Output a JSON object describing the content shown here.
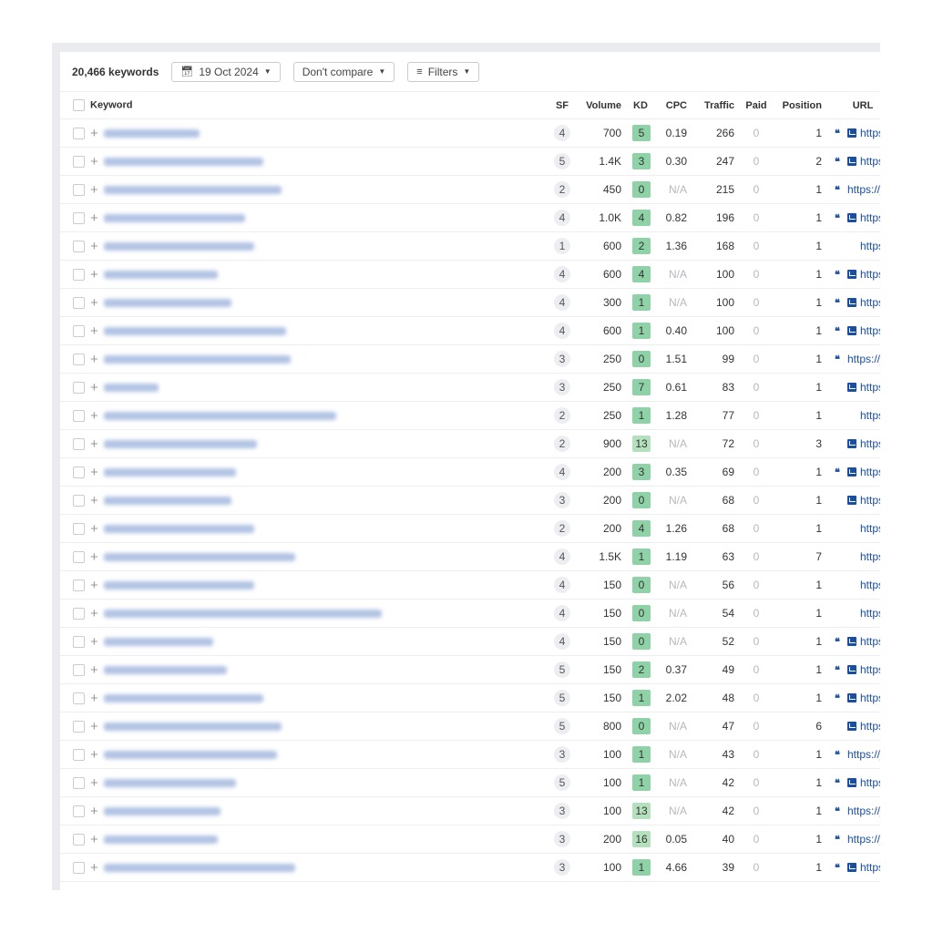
{
  "toolbar": {
    "keyword_count": "20,466 keywords",
    "date_label": "19 Oct 2024",
    "compare_label": "Don't compare",
    "filters_label": "Filters",
    "calendar_icon": "calendar-icon",
    "filter_icon": "filter-icon"
  },
  "columns": {
    "keyword": "Keyword",
    "sf": "SF",
    "volume": "Volume",
    "kd": "KD",
    "cpc": "CPC",
    "traffic": "Traffic",
    "paid": "Paid",
    "position": "Position",
    "url": "URL"
  },
  "colors": {
    "kd_easy": "#8fd2a7",
    "kd_light": "#b5e0bd",
    "link": "#1a4fa0"
  },
  "rows": [
    {
      "sf": "4",
      "volume": "700",
      "kd": "5",
      "cpc": "0.19",
      "traffic": "266",
      "paid": "0",
      "position": "1",
      "quote": true,
      "image": true,
      "url": "https"
    },
    {
      "sf": "5",
      "volume": "1.4K",
      "kd": "3",
      "cpc": "0.30",
      "traffic": "247",
      "paid": "0",
      "position": "2",
      "quote": true,
      "image": true,
      "url": "https"
    },
    {
      "sf": "2",
      "volume": "450",
      "kd": "0",
      "cpc": "N/A",
      "traffic": "215",
      "paid": "0",
      "position": "1",
      "quote": true,
      "image": false,
      "url": "https://j"
    },
    {
      "sf": "4",
      "volume": "1.0K",
      "kd": "4",
      "cpc": "0.82",
      "traffic": "196",
      "paid": "0",
      "position": "1",
      "quote": true,
      "image": true,
      "url": "https"
    },
    {
      "sf": "1",
      "volume": "600",
      "kd": "2",
      "cpc": "1.36",
      "traffic": "168",
      "paid": "0",
      "position": "1",
      "quote": false,
      "image": false,
      "url": "https://j"
    },
    {
      "sf": "4",
      "volume": "600",
      "kd": "4",
      "cpc": "N/A",
      "traffic": "100",
      "paid": "0",
      "position": "1",
      "quote": true,
      "image": true,
      "url": "https"
    },
    {
      "sf": "4",
      "volume": "300",
      "kd": "1",
      "cpc": "N/A",
      "traffic": "100",
      "paid": "0",
      "position": "1",
      "quote": true,
      "image": true,
      "url": "https"
    },
    {
      "sf": "4",
      "volume": "600",
      "kd": "1",
      "cpc": "0.40",
      "traffic": "100",
      "paid": "0",
      "position": "1",
      "quote": true,
      "image": true,
      "url": "https"
    },
    {
      "sf": "3",
      "volume": "250",
      "kd": "0",
      "cpc": "1.51",
      "traffic": "99",
      "paid": "0",
      "position": "1",
      "quote": true,
      "image": false,
      "url": "https://j"
    },
    {
      "sf": "3",
      "volume": "250",
      "kd": "7",
      "cpc": "0.61",
      "traffic": "83",
      "paid": "0",
      "position": "1",
      "quote": false,
      "image": true,
      "url": "https"
    },
    {
      "sf": "2",
      "volume": "250",
      "kd": "1",
      "cpc": "1.28",
      "traffic": "77",
      "paid": "0",
      "position": "1",
      "quote": false,
      "image": false,
      "url": "https://j"
    },
    {
      "sf": "2",
      "volume": "900",
      "kd": "13",
      "cpc": "N/A",
      "traffic": "72",
      "paid": "0",
      "position": "3",
      "quote": false,
      "image": true,
      "url": "https"
    },
    {
      "sf": "4",
      "volume": "200",
      "kd": "3",
      "cpc": "0.35",
      "traffic": "69",
      "paid": "0",
      "position": "1",
      "quote": true,
      "image": true,
      "url": "https"
    },
    {
      "sf": "3",
      "volume": "200",
      "kd": "0",
      "cpc": "N/A",
      "traffic": "68",
      "paid": "0",
      "position": "1",
      "quote": false,
      "image": true,
      "url": "https"
    },
    {
      "sf": "2",
      "volume": "200",
      "kd": "4",
      "cpc": "1.26",
      "traffic": "68",
      "paid": "0",
      "position": "1",
      "quote": false,
      "image": false,
      "url": "https://j"
    },
    {
      "sf": "4",
      "volume": "1.5K",
      "kd": "1",
      "cpc": "1.19",
      "traffic": "63",
      "paid": "0",
      "position": "7",
      "quote": false,
      "image": false,
      "url": "https://j"
    },
    {
      "sf": "4",
      "volume": "150",
      "kd": "0",
      "cpc": "N/A",
      "traffic": "56",
      "paid": "0",
      "position": "1",
      "quote": false,
      "image": false,
      "url": "https://j"
    },
    {
      "sf": "4",
      "volume": "150",
      "kd": "0",
      "cpc": "N/A",
      "traffic": "54",
      "paid": "0",
      "position": "1",
      "quote": false,
      "image": false,
      "url": "https://j"
    },
    {
      "sf": "4",
      "volume": "150",
      "kd": "0",
      "cpc": "N/A",
      "traffic": "52",
      "paid": "0",
      "position": "1",
      "quote": true,
      "image": true,
      "url": "https"
    },
    {
      "sf": "5",
      "volume": "150",
      "kd": "2",
      "cpc": "0.37",
      "traffic": "49",
      "paid": "0",
      "position": "1",
      "quote": true,
      "image": true,
      "url": "https"
    },
    {
      "sf": "5",
      "volume": "150",
      "kd": "1",
      "cpc": "2.02",
      "traffic": "48",
      "paid": "0",
      "position": "1",
      "quote": true,
      "image": true,
      "url": "https"
    },
    {
      "sf": "5",
      "volume": "800",
      "kd": "0",
      "cpc": "N/A",
      "traffic": "47",
      "paid": "0",
      "position": "6",
      "quote": false,
      "image": true,
      "url": "https"
    },
    {
      "sf": "3",
      "volume": "100",
      "kd": "1",
      "cpc": "N/A",
      "traffic": "43",
      "paid": "0",
      "position": "1",
      "quote": true,
      "image": false,
      "url": "https://j"
    },
    {
      "sf": "5",
      "volume": "100",
      "kd": "1",
      "cpc": "N/A",
      "traffic": "42",
      "paid": "0",
      "position": "1",
      "quote": true,
      "image": true,
      "url": "https"
    },
    {
      "sf": "3",
      "volume": "100",
      "kd": "13",
      "cpc": "N/A",
      "traffic": "42",
      "paid": "0",
      "position": "1",
      "quote": true,
      "image": false,
      "url": "https://j"
    },
    {
      "sf": "3",
      "volume": "200",
      "kd": "16",
      "cpc": "0.05",
      "traffic": "40",
      "paid": "0",
      "position": "1",
      "quote": true,
      "image": false,
      "url": "https://j"
    },
    {
      "sf": "3",
      "volume": "100",
      "kd": "1",
      "cpc": "4.66",
      "traffic": "39",
      "paid": "0",
      "position": "1",
      "quote": true,
      "image": true,
      "url": "https"
    }
  ]
}
